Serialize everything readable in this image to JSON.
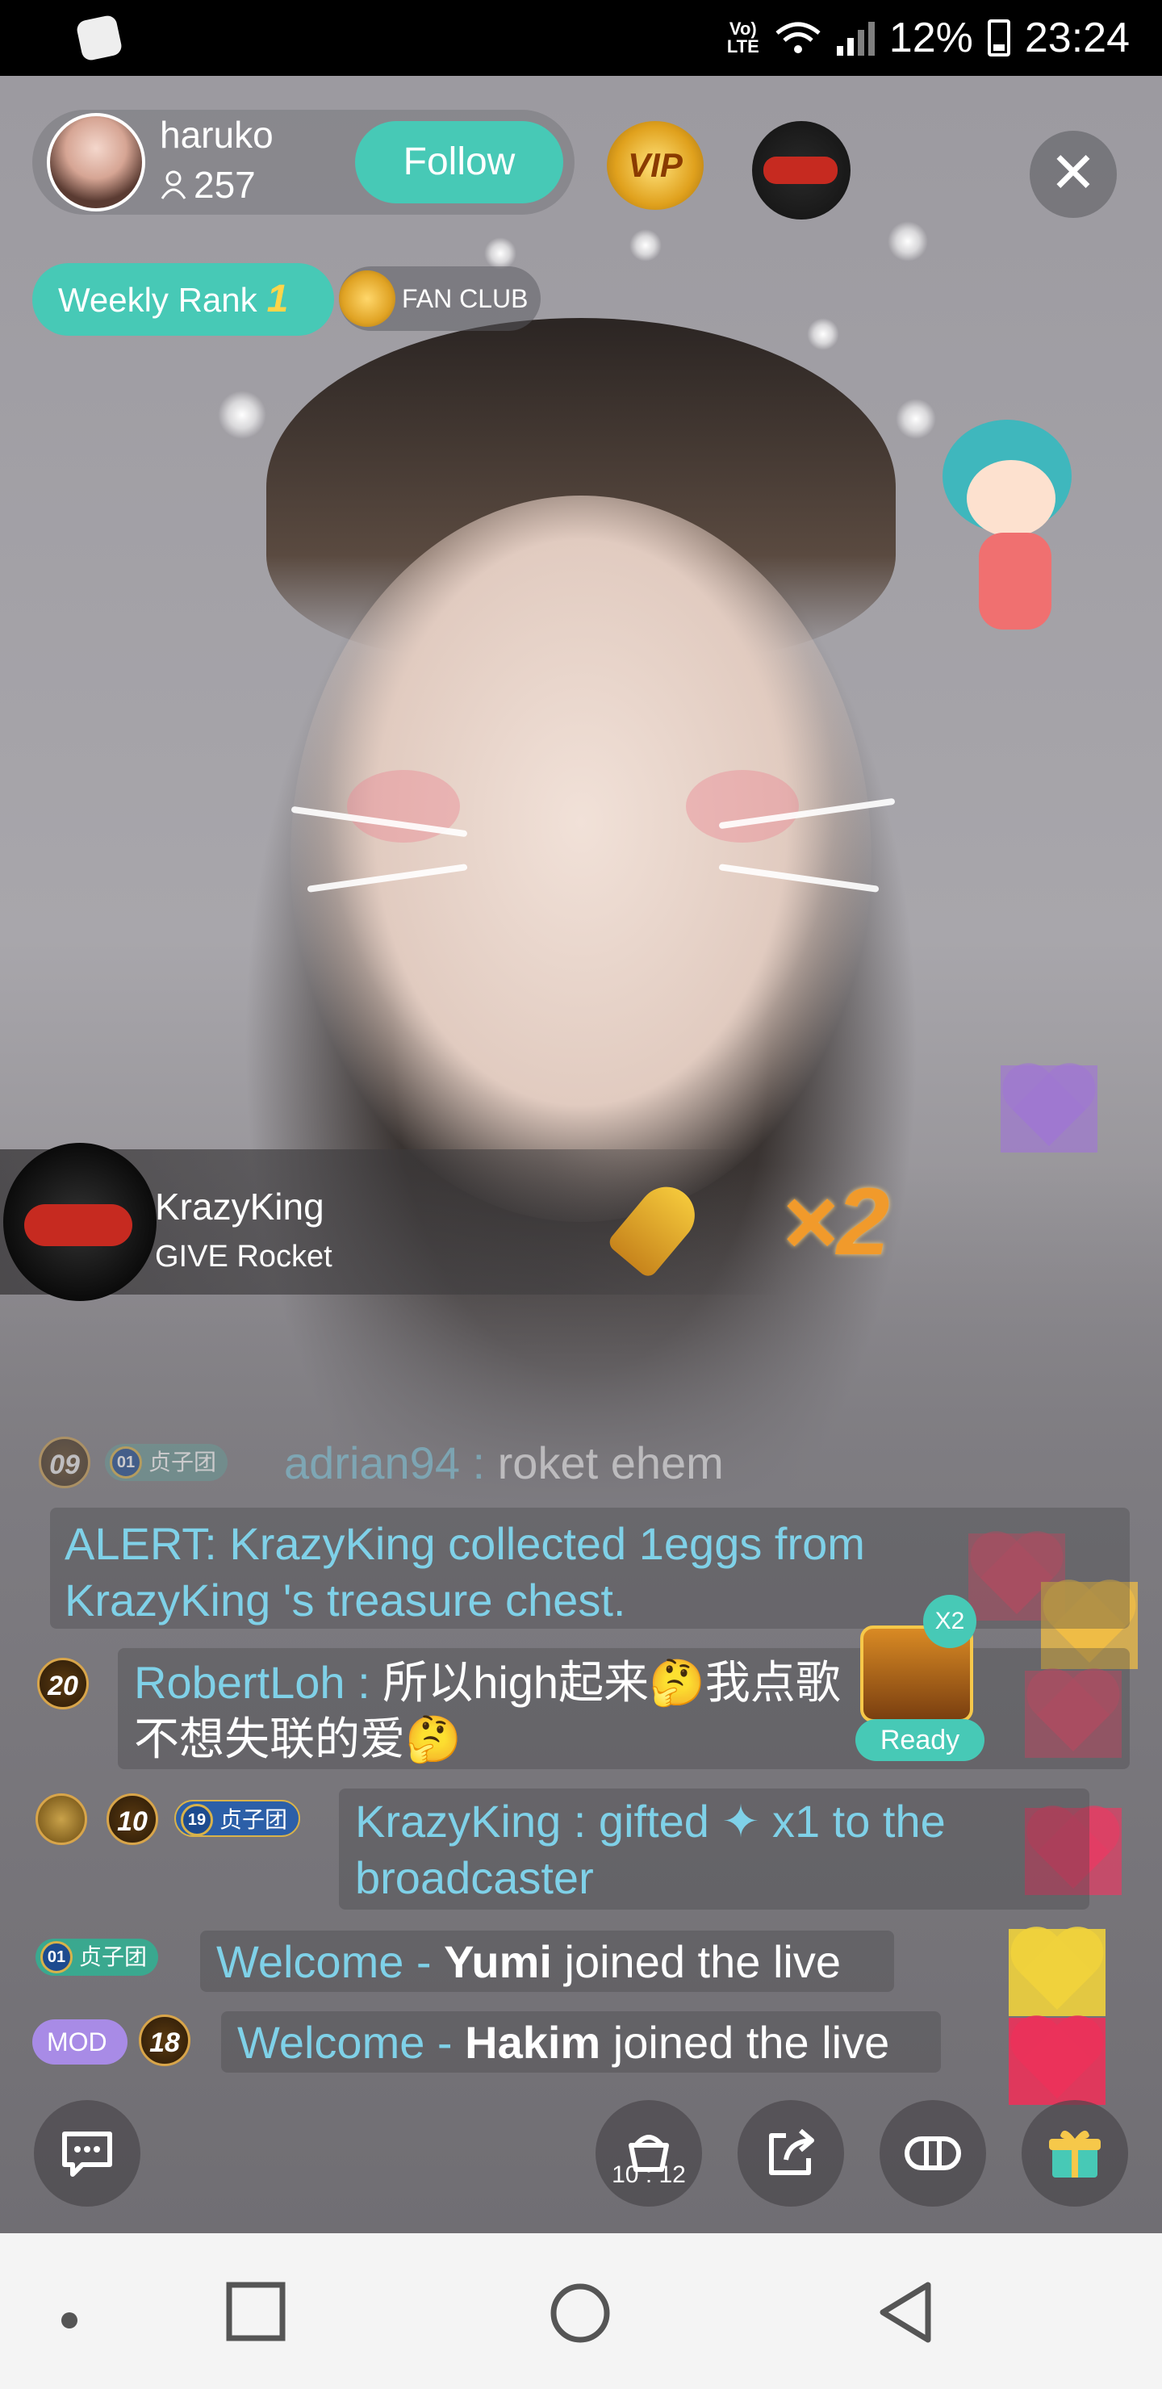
{
  "status_bar": {
    "battery": "12%",
    "time": "23:24",
    "network": "Vo) LTE"
  },
  "host": {
    "name": "haruko",
    "viewers": "257",
    "follow_label": "Follow"
  },
  "vip_label": "VIP",
  "rank": {
    "label": "Weekly Rank",
    "value": "1"
  },
  "fan_club": "FAN CLUB",
  "gift_banner": {
    "user": "KrazyKing",
    "action": "GIVE Rocket",
    "multiplier": "×2"
  },
  "chat": [
    {
      "level": "09",
      "tag": "贞子团",
      "tag_level": "01",
      "user": "adrian94",
      "sep": " : ",
      "text": "roket ehem"
    },
    {
      "alert": "ALERT: KrazyKing collected 1eggs from KrazyKing 's treasure chest."
    },
    {
      "level": "20",
      "user": "RobertLoh",
      "sep": " : ",
      "text_line1": "所以high起来🤔我点歌",
      "text_line2": "不想失联的爱🤔"
    },
    {
      "level": "10",
      "tag": "贞子团",
      "tag_level": "19",
      "user": "KrazyKing",
      "sep": " :  ",
      "text": "gifted",
      "text_after": " x1 to the",
      "text_line2": "broadcaster"
    },
    {
      "tag": "贞子团",
      "tag_level": "01",
      "prefix": "Welcome - ",
      "user": "Yumi",
      "text": " joined the live"
    },
    {
      "badge": "MOD",
      "level": "18",
      "prefix": "Welcome - ",
      "user": "Hakim",
      "text": " joined the live"
    }
  ],
  "treasure": {
    "count": "X2",
    "status": "Ready"
  },
  "bottom_bar": {
    "timer": "10 : 12"
  },
  "icons": [
    "chat-icon",
    "timer-icon",
    "share-icon",
    "game-icon",
    "gift-icon",
    "close-icon",
    "person-icon"
  ],
  "colors": {
    "accent": "#47c9b6",
    "chat_text": "#7fd1e8",
    "multiplier": "#f19a2b"
  }
}
